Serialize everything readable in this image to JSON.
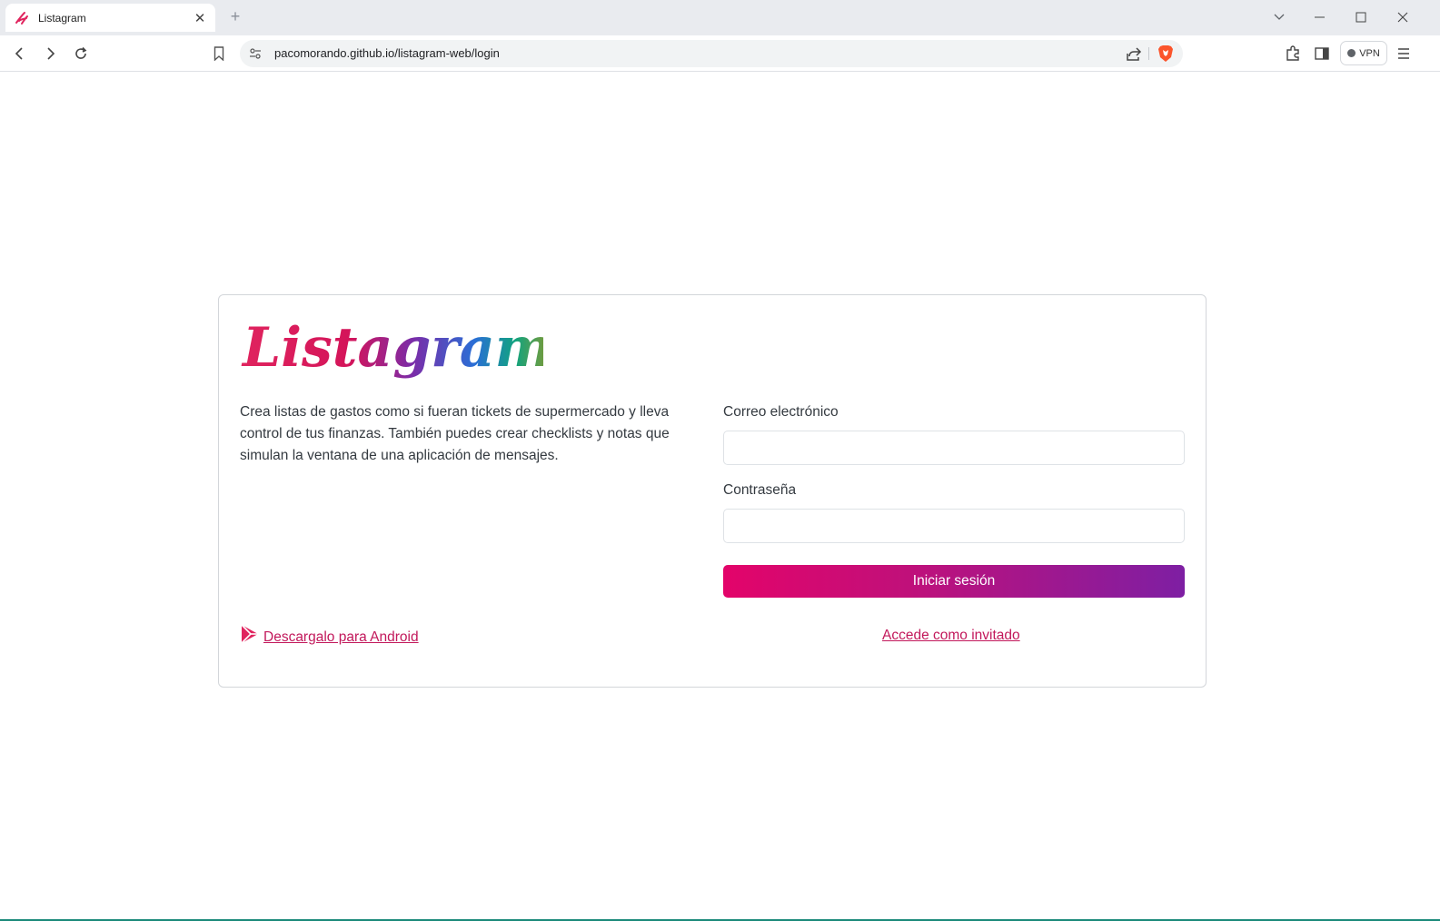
{
  "browser": {
    "tab_title": "Listagram",
    "tab_close_glyph": "✕",
    "new_tab_glyph": "+",
    "url": "pacomorando.github.io/listagram-web/login",
    "vpn_label": "VPN"
  },
  "page": {
    "logo_text": "Listagram",
    "description": "Crea listas de gastos como si fueran tickets de supermercado y lleva control de tus finanzas. También puedes crear checklists y notas que simulan la ventana de una aplicación de mensajes.",
    "email_label": "Correo electrónico",
    "email_value": "",
    "password_label": "Contraseña",
    "password_value": "",
    "login_button": "Iniciar sesión",
    "android_link": " Descargalo para Android",
    "guest_link": "Accede como invitado"
  },
  "colors": {
    "accent": "#c2185b",
    "button_start": "#e3046a",
    "button_end": "#7e1fa3"
  },
  "icons": [
    "listagram-favicon",
    "close-icon",
    "plus-icon",
    "chevron-down-icon",
    "minimize-icon",
    "maximize-icon",
    "back-icon",
    "forward-icon",
    "reload-icon",
    "bookmark-icon",
    "site-settings-icon",
    "share-icon",
    "brave-shield-icon",
    "extensions-icon",
    "sidebar-icon",
    "menu-icon",
    "play-store-icon"
  ]
}
